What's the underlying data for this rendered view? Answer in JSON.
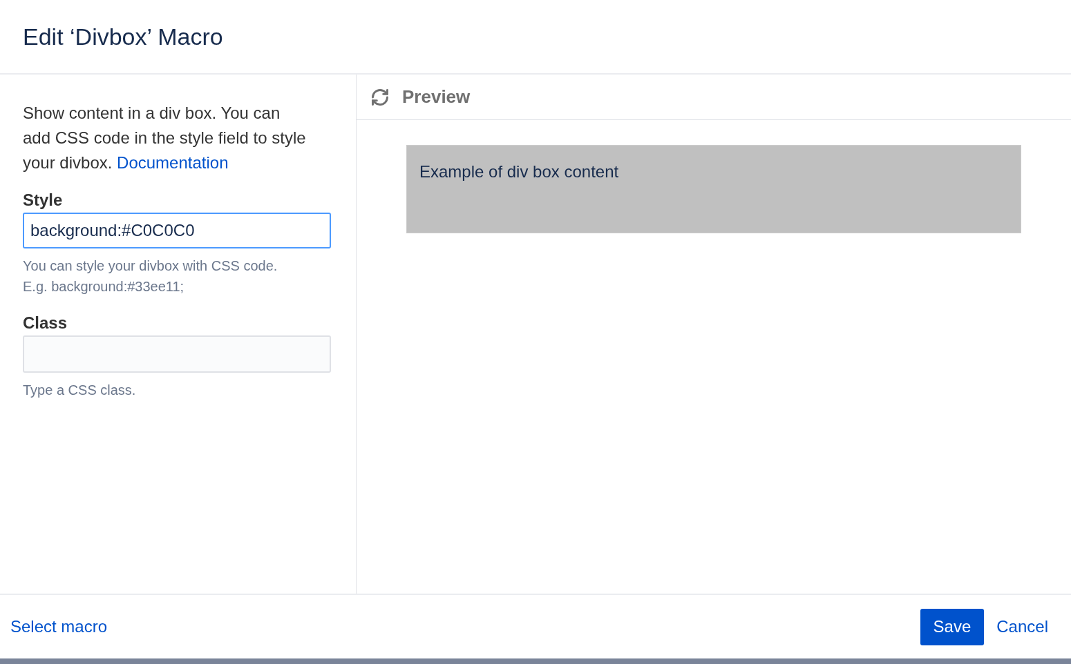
{
  "dialog": {
    "title": "Edit ‘Divbox’ Macro"
  },
  "form": {
    "description": "Show content in a div box. You can add CSS code in the style field to style your divbox.",
    "doc_link": "Documentation",
    "fields": [
      {
        "label": "Style",
        "value": "background:#C0C0C0",
        "focused": true,
        "help": [
          "You can style your divbox with CSS code.",
          "E.g. background:#33ee11;"
        ]
      },
      {
        "label": "Class",
        "focused": false,
        "help": [
          "Type a CSS class."
        ]
      }
    ]
  },
  "preview": {
    "title": "Preview",
    "box_text": "Example of div box content"
  },
  "footer": {
    "link": "Select macro",
    "buttons": [
      {
        "label": "Save",
        "kind": "primary"
      },
      {
        "label": "Cancel",
        "kind": "link"
      }
    ]
  }
}
